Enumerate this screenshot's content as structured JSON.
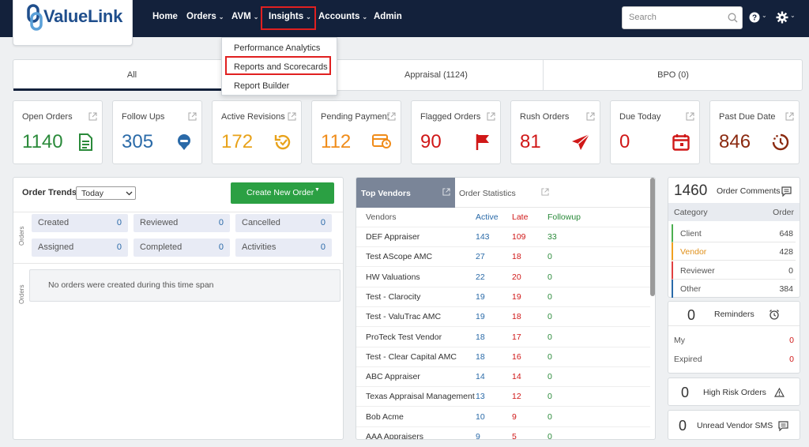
{
  "brand": {
    "logo_text": "ValueLink"
  },
  "nav": {
    "home": "Home",
    "orders": "Orders",
    "avm": "AVM",
    "insights": "Insights",
    "accounts": "Accounts",
    "admin": "Admin",
    "search_placeholder": "Search",
    "caret": "⌄"
  },
  "insights_menu": [
    "Performance Analytics",
    "Reports and Scorecards",
    "Report Builder"
  ],
  "tabs": [
    "All",
    "Appraisal (1124)",
    "BPO (0)"
  ],
  "cards": [
    {
      "label": "Open Orders",
      "value": "1140",
      "color": "#2a8a3a",
      "icon": "document-icon"
    },
    {
      "label": "Follow Ups",
      "value": "305",
      "color": "#2a6aa8",
      "icon": "chat-bubble-icon"
    },
    {
      "label": "Active Revisions",
      "value": "172",
      "color": "#e8a21a",
      "icon": "revision-icon"
    },
    {
      "label": "Pending Payment",
      "value": "112",
      "color": "#f08c1a",
      "icon": "payment-icon"
    },
    {
      "label": "Flagged Orders",
      "value": "90",
      "color": "#d01818",
      "icon": "flag-icon"
    },
    {
      "label": "Rush Orders",
      "value": "81",
      "color": "#d01818",
      "icon": "paper-plane-icon"
    },
    {
      "label": "Due Today",
      "value": "0",
      "color": "#d01818",
      "icon": "calendar-icon"
    },
    {
      "label": "Past Due Date",
      "value": "846",
      "color": "#8b2a10",
      "icon": "overdue-clock-icon"
    }
  ],
  "trends": {
    "title": "Order Trends",
    "period": "Today",
    "create_button": "Create New Order",
    "side_label": "Orders",
    "stats": [
      {
        "label": "Created",
        "value": "0"
      },
      {
        "label": "Reviewed",
        "value": "0"
      },
      {
        "label": "Cancelled",
        "value": "0"
      },
      {
        "label": "Assigned",
        "value": "0"
      },
      {
        "label": "Completed",
        "value": "0"
      },
      {
        "label": "Activities",
        "value": "0"
      }
    ],
    "empty_message": "No orders were created during this time span"
  },
  "vendors": {
    "tab_top": "Top Vendors",
    "tab_stats": "Order Statistics",
    "columns": [
      "Vendors",
      "Active",
      "Late",
      "Followup"
    ],
    "rows": [
      [
        "DEF Appraiser",
        "143",
        "109",
        "33"
      ],
      [
        "Test AScope AMC",
        "27",
        "18",
        "0"
      ],
      [
        "HW Valuations",
        "22",
        "20",
        "0"
      ],
      [
        "Test - Clarocity",
        "19",
        "19",
        "0"
      ],
      [
        "Test - ValuTrac AMC",
        "19",
        "18",
        "0"
      ],
      [
        "ProTeck Test Vendor",
        "18",
        "17",
        "0"
      ],
      [
        "Test - Clear Capital AMC",
        "18",
        "16",
        "0"
      ],
      [
        "ABC Appraiser",
        "14",
        "14",
        "0"
      ],
      [
        "Texas Appraisal Management",
        "13",
        "12",
        "0"
      ],
      [
        "Bob Acme",
        "10",
        "9",
        "0"
      ],
      [
        "AAA Appraisers",
        "9",
        "5",
        "0"
      ]
    ]
  },
  "comments": {
    "count": "1460",
    "label": "Order Comments",
    "col_category": "Category",
    "col_order": "Order",
    "rows": [
      {
        "label": "Client",
        "value": "648",
        "color": "#4caf50"
      },
      {
        "label": "Vendor",
        "value": "428",
        "color": "#f0a020"
      },
      {
        "label": "Reviewer",
        "value": "0",
        "color": "#e04040"
      },
      {
        "label": "Other",
        "value": "384",
        "color": "#2a6aa8"
      }
    ]
  },
  "reminders": {
    "count": "0",
    "label": "Reminders",
    "rows": [
      {
        "label": "My",
        "value": "0"
      },
      {
        "label": "Expired",
        "value": "0"
      }
    ]
  },
  "high_risk": {
    "count": "0",
    "label": "High Risk Orders"
  },
  "sms": {
    "count": "0",
    "label": "Unread Vendor SMS"
  }
}
